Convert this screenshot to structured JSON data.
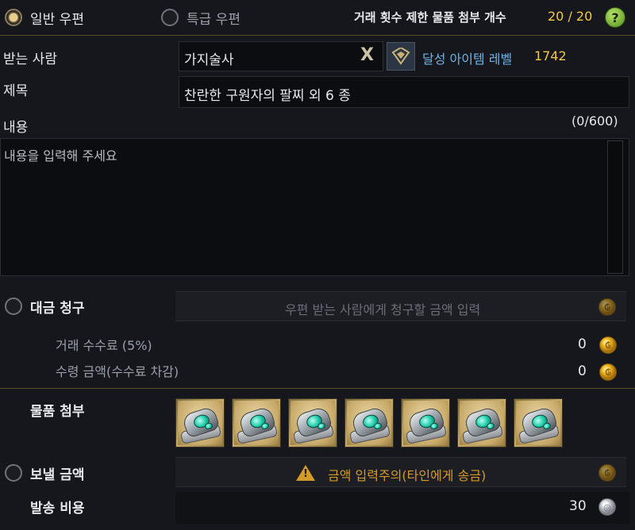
{
  "header": {
    "normal_mail_label": "일반 우편",
    "express_mail_label": "특급 우편",
    "limit_label": "거래 횟수 제한 물품 첨부 개수",
    "limit_value": "20 / 20",
    "help_glyph": "?"
  },
  "recipient": {
    "label": "받는 사람",
    "value": "가지술사",
    "clear_glyph": "X",
    "level_label": "달성 아이템 레벨",
    "level_value": "1742"
  },
  "subject": {
    "label": "제목",
    "value": "찬란한 구원자의 팔찌 외 6 종"
  },
  "content": {
    "label": "내용",
    "counter": "(0/600)",
    "placeholder": "내용을 입력해 주세요"
  },
  "cod": {
    "label": "대금 청구",
    "input_placeholder": "우편 받는 사람에게 청구할 금액 입력",
    "fee_label": "거래 수수료 (5%)",
    "fee_value": "0",
    "receive_label": "수령 금액(수수료 차감)",
    "receive_value": "0"
  },
  "attachments": {
    "label": "물품 첨부",
    "items": [
      {
        "name": "bracelet-item-icon"
      },
      {
        "name": "bracelet-item-icon"
      },
      {
        "name": "bracelet-item-icon"
      },
      {
        "name": "bracelet-item-icon"
      },
      {
        "name": "bracelet-item-icon"
      },
      {
        "name": "bracelet-item-icon"
      },
      {
        "name": "bracelet-item-icon"
      }
    ]
  },
  "send_gold": {
    "label": "보낼 금액",
    "warning_text": "금액 입력주의(타인에게 송금)"
  },
  "shipping": {
    "label": "발송 비용",
    "value": "30"
  },
  "colors": {
    "accent_gold": "#f2c94c",
    "accent_blue": "#6fb3e6",
    "warning_orange": "#d49a2a"
  }
}
